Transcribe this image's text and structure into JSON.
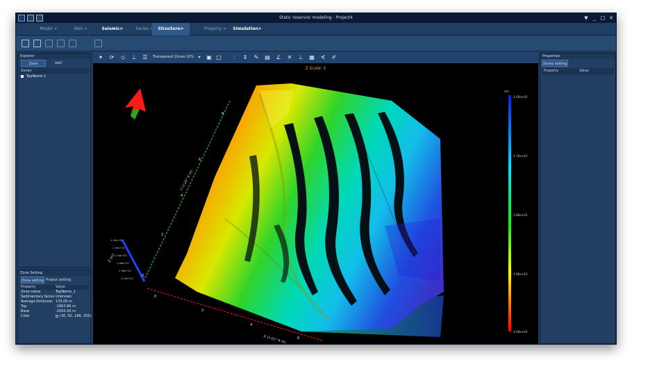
{
  "window": {
    "title": "Static reservoir modeling - Project4",
    "controls": [
      "▼",
      "_",
      "□",
      "✕"
    ]
  },
  "menu": [
    {
      "label": "Model",
      "arrow": ">",
      "style": "dim"
    },
    {
      "label": "Well",
      "arrow": ">",
      "style": "dim"
    },
    {
      "label": "Seismic",
      "arrow": ">",
      "style": "bold"
    },
    {
      "label": "Facies",
      "arrow": ">",
      "style": "dim"
    },
    {
      "label": "Structure",
      "arrow": ">",
      "style": "active"
    },
    {
      "label": "Property",
      "arrow": ">",
      "style": "dim"
    },
    {
      "label": "Simulation",
      "arrow": ">",
      "style": "bold"
    }
  ],
  "explorer": {
    "header": "Explorer",
    "tabs": [
      "Zone",
      "well"
    ],
    "tree_header": "Zones",
    "items": [
      "TopName 1"
    ]
  },
  "zone_setting": {
    "header": "Zone Setting",
    "tabs": [
      "Zone setting",
      "Project setting"
    ],
    "columns": [
      "Property",
      "Value"
    ],
    "rows": [
      {
        "prop": "Zone name",
        "value": "TopName_1"
      },
      {
        "prop": "Sedimentary facies...",
        "value": "Unknown"
      },
      {
        "prop": "Average thickness",
        "value": "133.00 m"
      },
      {
        "prop": "Top",
        "value": "-1803.86 m"
      },
      {
        "prop": "Base",
        "value": "-2000.00 m"
      },
      {
        "prop": "Color",
        "value": "(30, 92, 168, 255)"
      }
    ],
    "color_hex": "#1e5ca8"
  },
  "viewport": {
    "toolbar_text": "Transparent Zones",
    "toolbar_pct": "10%",
    "z_scale": "Z Scale: 5",
    "axis_x_label": "X (×10^4 m)",
    "axis_y_label": "Y (×10^4 m)",
    "axis_z_label": "Z (m)",
    "x_ticks": [
      "0",
      "2",
      "4",
      "6"
    ],
    "y_ticks": [
      "0",
      "2",
      "4",
      "6",
      "8"
    ],
    "z_ticks": [
      "-1.90e+03",
      "-1.92e+03",
      "-1.94e+03",
      "-1.96e+03",
      "-1.98e+03",
      "-2.00e+03"
    ]
  },
  "colorbar": {
    "unit": "(m)",
    "labels": [
      "-1.60e+03",
      "-1.70e+03",
      "-1.80e+03",
      "-1.90e+03",
      "-2.00e+03"
    ],
    "colors": [
      "#0a1fd8",
      "#00e1ff",
      "#1fe61c",
      "#ffff00",
      "#ff0000"
    ]
  },
  "properties": {
    "header": "Properties",
    "tab": "Zones setting",
    "columns": [
      "Property",
      "Value"
    ]
  },
  "colors": {
    "accent": "#2f5a8c",
    "bg": "#1f3b5c",
    "menu_active": "#2f5a8c",
    "arrow": "#ff1a1a"
  }
}
